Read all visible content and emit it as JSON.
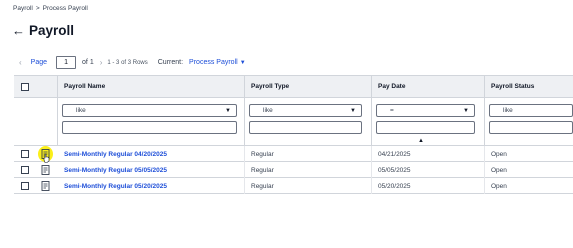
{
  "breadcrumb": {
    "items": [
      "Payroll",
      "Process Payroll"
    ],
    "separator": ">"
  },
  "page": {
    "title": "Payroll",
    "back_icon": "left-arrow-icon"
  },
  "pager": {
    "prev_icon": "chevron-left-icon",
    "page_label": "Page",
    "page_value": "1",
    "of_total": "of 1",
    "next_icon": "chevron-right-icon",
    "rows_info": "1 - 3 of 3 Rows",
    "current_label": "Current:",
    "current_view": "Process Payroll"
  },
  "grid": {
    "columns": [
      {
        "label": "Payroll Name",
        "filter_op": "like"
      },
      {
        "label": "Payroll Type",
        "filter_op": "like"
      },
      {
        "label": "Pay Date",
        "filter_op": "="
      },
      {
        "label": "Payroll Status",
        "filter_op": "like"
      }
    ],
    "sort": {
      "column": "Pay Date",
      "direction": "ascending"
    },
    "rows": [
      {
        "name": "Semi-Monthly Regular 04/20/2025",
        "type": "Regular",
        "pay_date": "04/21/2025",
        "status": "Open",
        "highlighted": true
      },
      {
        "name": "Semi-Monthly Regular 05/05/2025",
        "type": "Regular",
        "pay_date": "05/05/2025",
        "status": "Open",
        "highlighted": false
      },
      {
        "name": "Semi-Monthly Regular 05/20/2025",
        "type": "Regular",
        "pay_date": "05/20/2025",
        "status": "Open",
        "highlighted": false
      }
    ]
  },
  "colors": {
    "link": "#1d4ed8",
    "header_bg": "#eef0f3",
    "highlight": "#fbef1a"
  }
}
